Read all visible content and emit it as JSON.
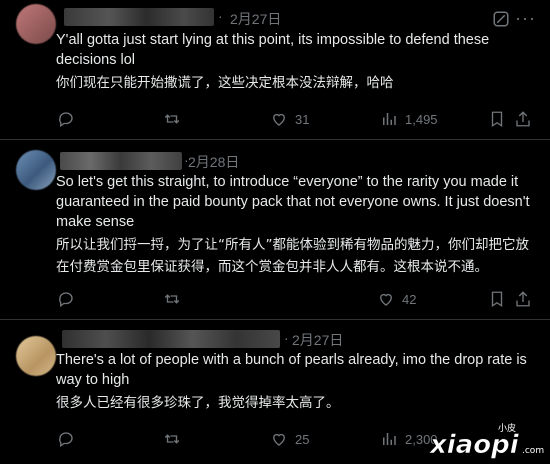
{
  "posts": [
    {
      "date": "2月27日",
      "text_en": "Y'all gotta just start lying at this point, its impossible to defend these decisions lol",
      "text_zh": "你们现在只能开始撒谎了，这些决定根本没法辩解，哈哈",
      "likes": "31",
      "views": "1,495"
    },
    {
      "date": "2月28日",
      "text_en": "So let's get this straight, to introduce “everyone” to the rarity you made it guaranteed in the paid bounty pack that not everyone owns. It just doesn't make sense",
      "text_zh": "所以让我们捋一捋，为了让“所有人”都能体验到稀有物品的魅力，你们却把它放在付费赏金包里保证获得，而这个赏金包并非人人都有。这根本说不通。",
      "likes": "42",
      "views": ""
    },
    {
      "date": "2月27日",
      "text_en": "There's a lot of people with a bunch of pearls already, imo the drop rate is way to high",
      "text_zh": "很多人已经有很多珍珠了，我觉得掉率太高了。",
      "likes": "25",
      "views": "2,300"
    }
  ],
  "watermark": {
    "small": "小皮",
    "brand": "xiaopi",
    "site": ".com"
  },
  "colors": {
    "background": "#000000",
    "text": "#e7e9ea",
    "muted": "#71767b",
    "divider": "#2f3336",
    "watermark": "#ffffff"
  },
  "icons": [
    "reply-icon",
    "repost-icon",
    "like-icon",
    "views-icon",
    "bookmark-icon",
    "share-icon",
    "grok-icon",
    "more-icon"
  ]
}
